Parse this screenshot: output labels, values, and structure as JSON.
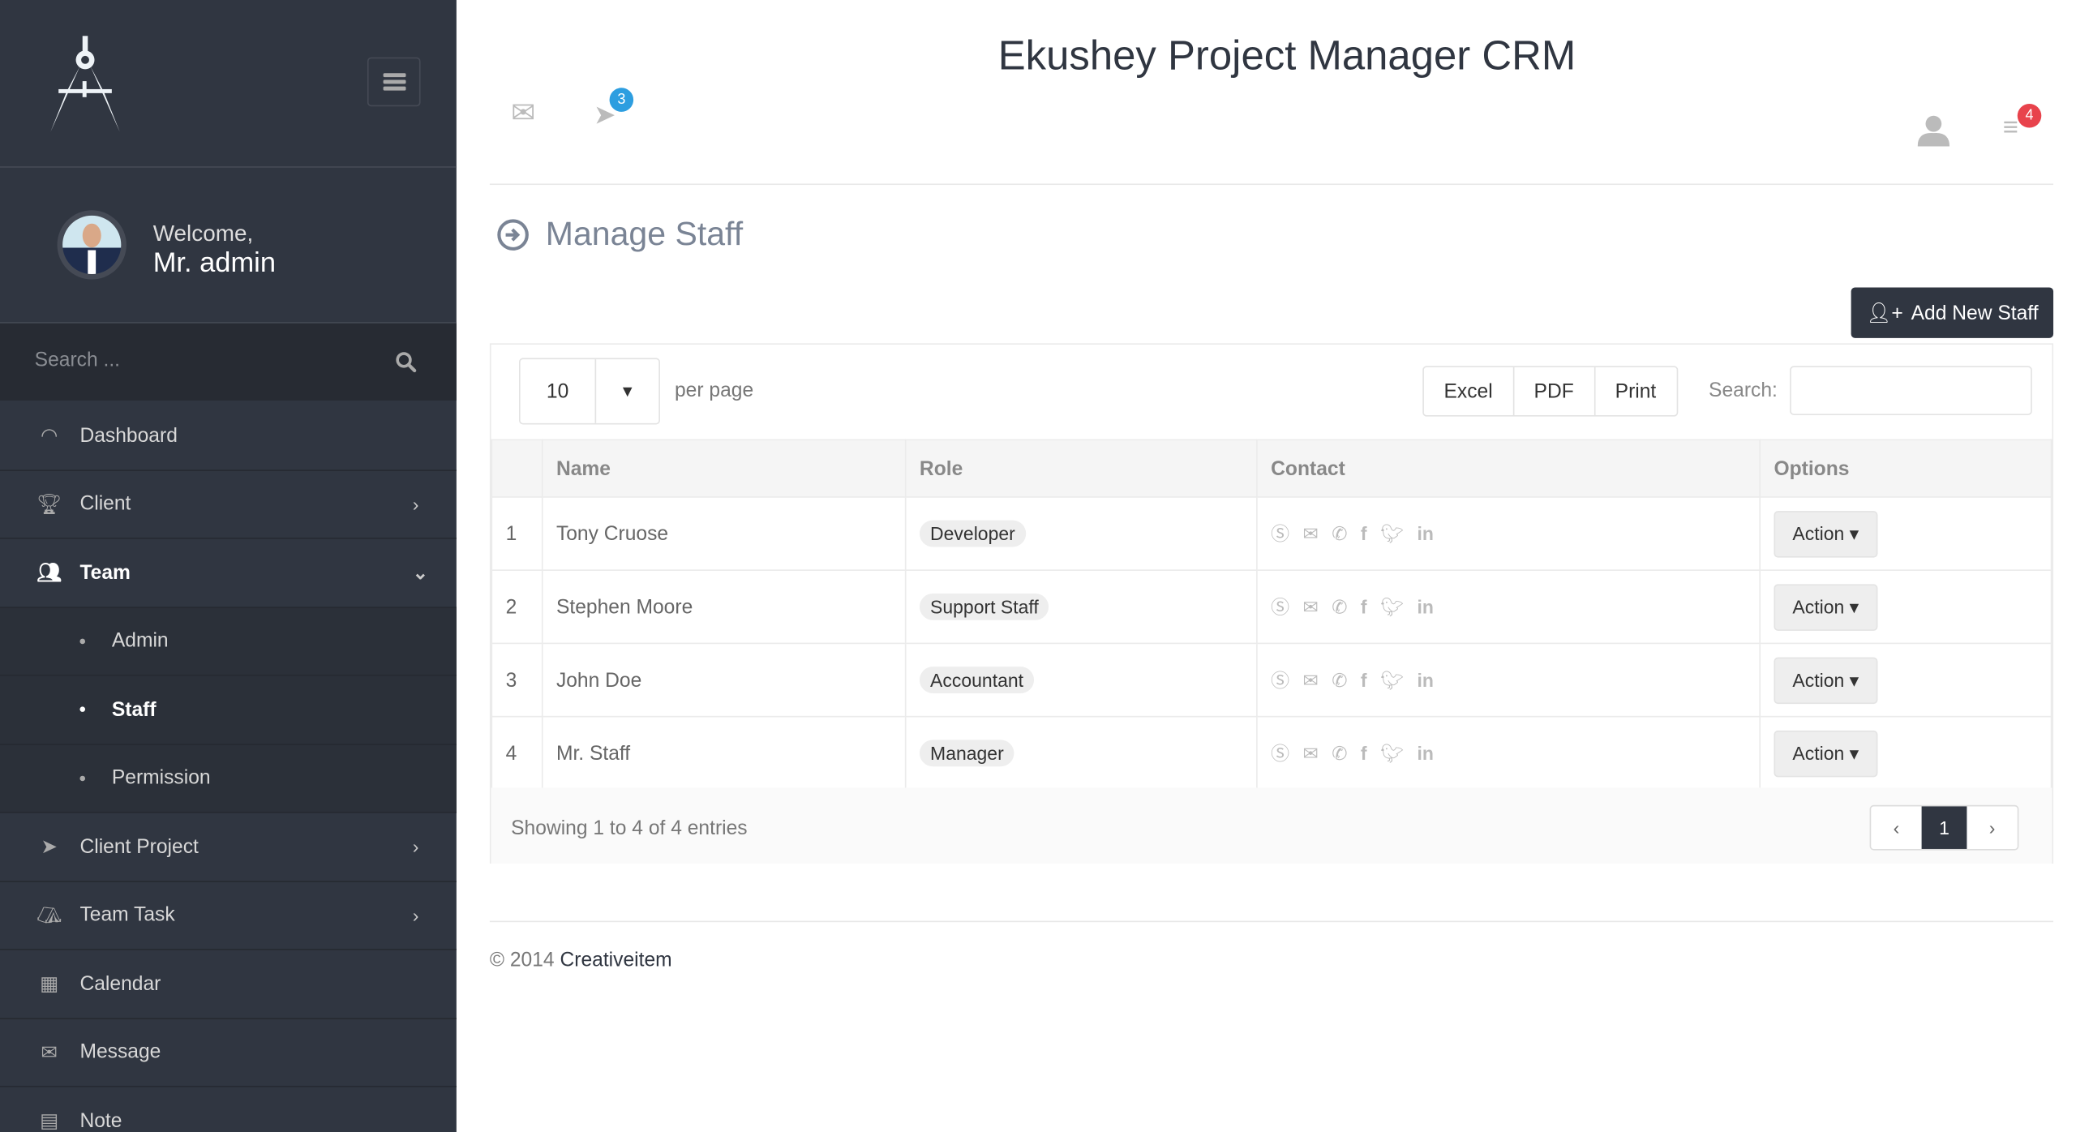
{
  "header": {
    "title": "Ekushey Project Manager CRM",
    "notifications_count": "3",
    "tasks_count": "4"
  },
  "sidebar": {
    "welcome": "Welcome,",
    "user": "Mr. admin",
    "search_placeholder": "Search ...",
    "items": [
      {
        "label": "Dashboard"
      },
      {
        "label": "Client"
      },
      {
        "label": "Team"
      },
      {
        "label": "Admin"
      },
      {
        "label": "Staff"
      },
      {
        "label": "Permission"
      },
      {
        "label": "Client Project"
      },
      {
        "label": "Team Task"
      },
      {
        "label": "Calendar"
      },
      {
        "label": "Message"
      },
      {
        "label": "Note"
      }
    ]
  },
  "page": {
    "title": "Manage Staff",
    "add_button": "Add New Staff"
  },
  "table_controls": {
    "per_page_value": "10",
    "per_page_label": "per page",
    "excel": "Excel",
    "pdf": "PDF",
    "print": "Print",
    "search_label": "Search:"
  },
  "table": {
    "columns": [
      "",
      "Name",
      "Role",
      "Contact",
      "Options"
    ],
    "rows": [
      {
        "n": "1",
        "name": "Tony Cruose",
        "role": "Developer",
        "action": "Action"
      },
      {
        "n": "2",
        "name": "Stephen Moore",
        "role": "Support Staff",
        "action": "Action"
      },
      {
        "n": "3",
        "name": "John Doe",
        "role": "Accountant",
        "action": "Action"
      },
      {
        "n": "4",
        "name": "Mr. Staff",
        "role": "Manager",
        "action": "Action"
      }
    ],
    "showing": "Showing 1 to 4 of 4 entries",
    "current_page": "1"
  },
  "footer": {
    "copyright": "© 2014",
    "company": "Creativeitem"
  },
  "colors": {
    "sidebar": "#303641",
    "badge_blue": "#2d9ee0",
    "badge_red": "#e8434c"
  }
}
